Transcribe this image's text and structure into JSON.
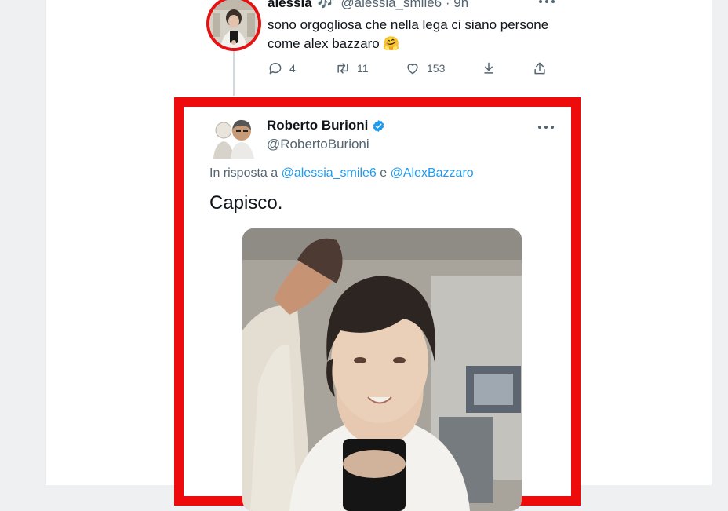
{
  "parent_tweet": {
    "name": "alessia",
    "name_emoji": "🎶",
    "handle": "@alessia_smile6",
    "separator": "·",
    "time": "9h",
    "text": "sono orgogliosa che nella lega ci siano persone come alex bazzaro",
    "text_emoji": "🤗",
    "reply_count": "4",
    "retweet_count": "11",
    "like_count": "153"
  },
  "highlighted_tweet": {
    "name": "Roberto Burioni",
    "handle": "@RobertoBurioni",
    "reply_prefix": "In risposta a",
    "mention_1": "@alessia_smile6",
    "conjunction": "e",
    "mention_2": "@AlexBazzaro",
    "text": "Capisco."
  },
  "colors": {
    "highlight_border": "#ee0b0b",
    "avatar_ring": "#e41212",
    "link_blue": "#1d9bf0",
    "secondary_text": "#536471",
    "verified_badge": "#1d9bf0"
  },
  "icons": [
    "reply-icon",
    "retweet-icon",
    "like-icon",
    "download-icon",
    "share-icon",
    "verified-badge-icon",
    "more-options-icon"
  ]
}
